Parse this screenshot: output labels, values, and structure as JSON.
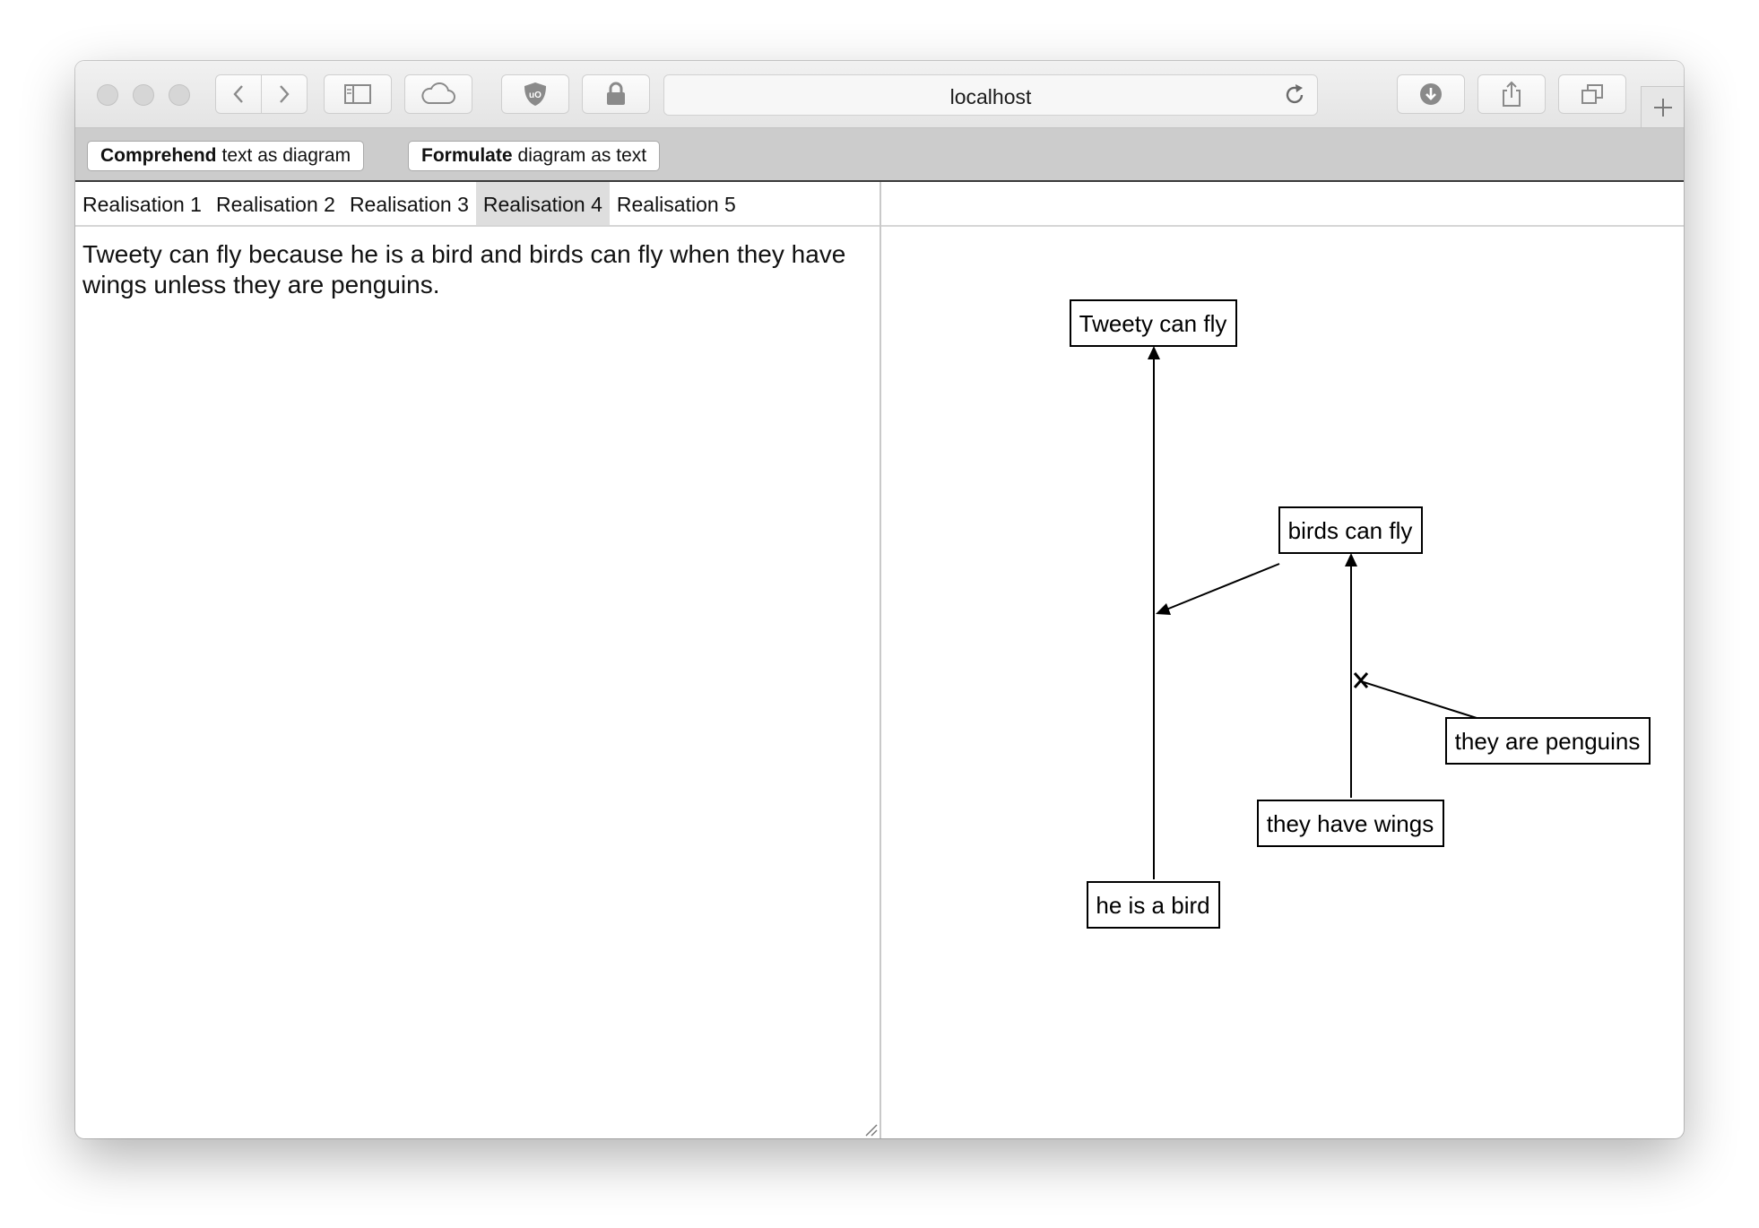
{
  "browser": {
    "url": "localhost"
  },
  "commands": {
    "comprehend": {
      "bold": "Comprehend",
      "rest": "text as diagram"
    },
    "formulate": {
      "bold": "Formulate",
      "rest": "diagram as text"
    }
  },
  "tabs": [
    {
      "label": "Realisation 1",
      "active": false
    },
    {
      "label": "Realisation 2",
      "active": false
    },
    {
      "label": "Realisation 3",
      "active": false
    },
    {
      "label": "Realisation 4",
      "active": true
    },
    {
      "label": "Realisation 5",
      "active": false
    }
  ],
  "editor": {
    "text": "Tweety can fly because he is a bird and birds can fly when they have wings unless they are penguins."
  },
  "diagram": {
    "nodes": {
      "tweety": "Tweety can fly",
      "birds": "birds can fly",
      "penguins": "they are penguins",
      "wings": "they have wings",
      "bird": "he is a bird"
    },
    "edges": [
      {
        "from": "bird",
        "to": "tweety",
        "type": "support"
      },
      {
        "from": "birds",
        "to": "bird→tweety",
        "type": "support"
      },
      {
        "from": "wings",
        "to": "birds",
        "type": "support"
      },
      {
        "from": "penguins",
        "to": "wings→birds",
        "type": "undercut"
      }
    ]
  }
}
